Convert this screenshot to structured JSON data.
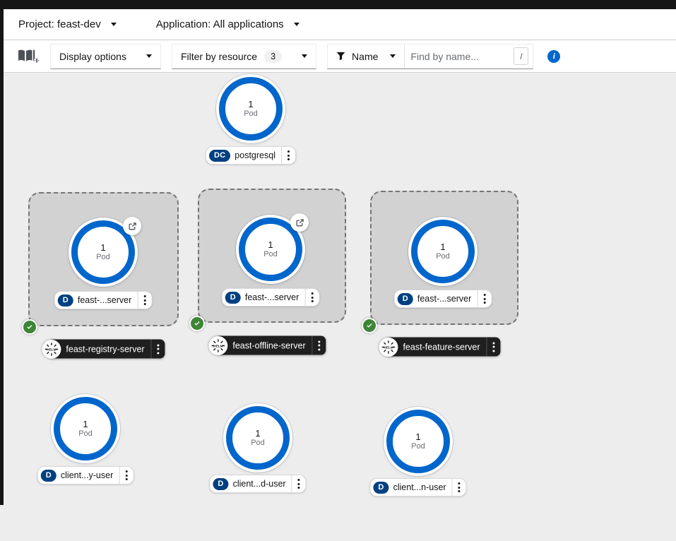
{
  "context_bar": {
    "project": "Project: feast-dev",
    "application": "Application: All applications"
  },
  "toolbar": {
    "display_options": "Display options",
    "filter_by_resource": "Filter by resource",
    "filter_count": "3",
    "filter_type": "Name",
    "search_placeholder": "Find by name...",
    "search_shortcut": "/"
  },
  "colors": {
    "accent_blue": "#0066cc",
    "badge_navy": "#004080",
    "success_green": "#3e8635",
    "canvas_gray": "#ededed",
    "group_fill": "#d2d2d2",
    "dark_label": "#1f1f1f"
  },
  "topology": {
    "standalone": [
      {
        "badge": "DC",
        "name": "postgresql",
        "count": "1",
        "unit": "Pod"
      }
    ],
    "helm_groups": [
      {
        "release": "feast-registry-server",
        "workload": {
          "badge": "D",
          "name": "feast-...server",
          "count": "1",
          "unit": "Pod"
        },
        "status": "succeeded",
        "external_link": true
      },
      {
        "release": "feast-offline-server",
        "workload": {
          "badge": "D",
          "name": "feast-...server",
          "count": "1",
          "unit": "Pod"
        },
        "status": "succeeded",
        "external_link": true
      },
      {
        "release": "feast-feature-server",
        "workload": {
          "badge": "D",
          "name": "feast-...server",
          "count": "1",
          "unit": "Pod"
        },
        "status": "succeeded",
        "external_link": false
      }
    ],
    "clients": [
      {
        "badge": "D",
        "name": "client...y-user",
        "count": "1",
        "unit": "Pod"
      },
      {
        "badge": "D",
        "name": "client...d-user",
        "count": "1",
        "unit": "Pod"
      },
      {
        "badge": "D",
        "name": "client...n-user",
        "count": "1",
        "unit": "Pod"
      }
    ]
  }
}
